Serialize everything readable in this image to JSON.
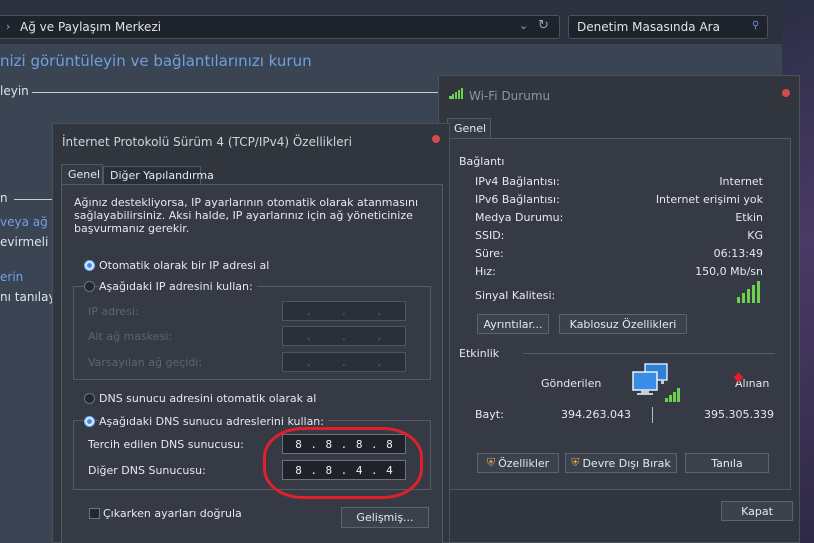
{
  "explorer": {
    "address": "Ağ ve Paylaşım Merkezi",
    "search_placeholder": "Denetim Masasında Ara",
    "heading": "nizi görüntüleyin ve bağlantılarınızı kurun",
    "section_active": "leyin",
    "section_change": "n",
    "link_1": "veya ağ k",
    "text_1": "evirmeli v",
    "link_2": "erin",
    "text_2": "nı tanılayın"
  },
  "ipv4_dialog": {
    "title": "İnternet Protokolü Sürüm 4 (TCP/IPv4) Özellikleri",
    "tabs": [
      "Genel",
      "Diğer Yapılandırma"
    ],
    "description": "Ağınız destekliyorsa, IP ayarlarının otomatik olarak atanmasını sağlayabilirsiniz. Aksi halde, IP ayarlarınız için ağ yöneticinize başvurmanız gerekir.",
    "radio_auto_ip": "Otomatik olarak bir IP adresi al",
    "radio_manual_ip": "Aşağıdaki IP adresini kullan:",
    "ip_address_label": "IP adresi:",
    "subnet_label": "Alt ağ maskesi:",
    "gateway_label": "Varsayılan ağ geçidi:",
    "radio_auto_dns": "DNS sunucu adresini otomatik olarak al",
    "radio_manual_dns": "Aşağıdaki DNS sunucu adreslerini kullan:",
    "preferred_dns_label": "Tercih edilen DNS sunucusu:",
    "alternate_dns_label": "Diğer DNS Sunucusu:",
    "preferred_dns": [
      "8",
      "8",
      "8",
      "8"
    ],
    "alternate_dns": [
      "8",
      "8",
      "4",
      "4"
    ],
    "validate_checkbox": "Çıkarken ayarları doğrula",
    "advanced_button": "Gelişmiş..."
  },
  "wifi_dialog": {
    "title": "Wi-Fi Durumu",
    "tab": "Genel",
    "connection_header": "Bağlantı",
    "rows": [
      {
        "label": "IPv4 Bağlantısı:",
        "value": "Internet"
      },
      {
        "label": "IPv6 Bağlantısı:",
        "value": "Internet erişimi yok"
      },
      {
        "label": "Medya Durumu:",
        "value": "Etkin"
      },
      {
        "label": "SSID:",
        "value": "KG"
      },
      {
        "label": "Süre:",
        "value": "06:13:49"
      },
      {
        "label": "Hız:",
        "value": "150,0 Mb/sn"
      }
    ],
    "signal_label": "Sinyal Kalitesi:",
    "signal_level": 5,
    "signal_max": 5,
    "details_button": "Ayrıntılar...",
    "wireless_props_button": "Kablosuz Özellikleri",
    "activity_header": "Etkinlik",
    "sent_label": "Gönderilen",
    "received_label": "Alınan",
    "bytes_label": "Bayt:",
    "bytes_sent": "394.263.043",
    "bytes_received": "395.305.339",
    "properties_button": "Özellikler",
    "disable_button": "Devre Dışı Bırak",
    "diagnose_button": "Tanıla",
    "close_button": "Kapat"
  },
  "colors": {
    "accent": "#3d8ee6",
    "link": "#6fa0e0",
    "highlight": "#e0202a",
    "signal": "#6ed04f"
  }
}
